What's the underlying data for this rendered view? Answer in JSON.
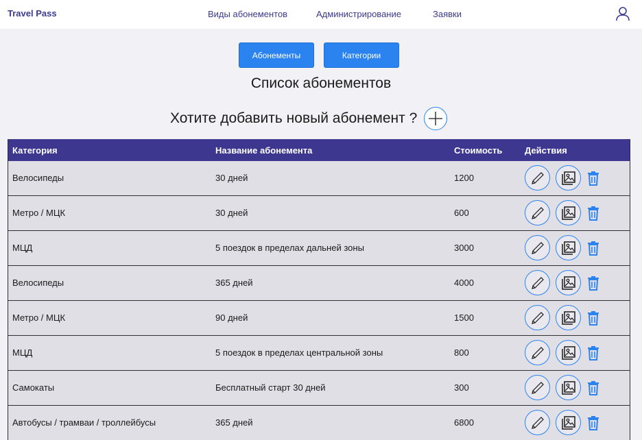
{
  "header": {
    "brand": "Travel Pass",
    "nav": [
      "Виды абонементов",
      "Администрирование",
      "Заявки"
    ]
  },
  "tabs": [
    "Абонементы",
    "Категории"
  ],
  "title": "Список абонементов",
  "add_prompt": "Хотите добавить новый абонемент ?",
  "table": {
    "columns": [
      "Категория",
      "Название абонемента",
      "Стоимость",
      "Действия"
    ],
    "rows": [
      {
        "category": "Велосипеды",
        "name": "30 дней",
        "price": "1200"
      },
      {
        "category": "Метро / МЦК",
        "name": "30 дней",
        "price": "600"
      },
      {
        "category": "МЦД",
        "name": "5 поездок в пределах дальней зоны",
        "price": "3000"
      },
      {
        "category": "Велосипеды",
        "name": "365 дней",
        "price": "4000"
      },
      {
        "category": "Метро / МЦК",
        "name": "90 дней",
        "price": "1500"
      },
      {
        "category": "МЦД",
        "name": "5 поездок в пределах центральной зоны",
        "price": "800"
      },
      {
        "category": "Самокаты",
        "name": "Бесплатный старт 30 дней",
        "price": "300"
      },
      {
        "category": "Автобусы / трамваи / троллейбусы",
        "name": "365 дней",
        "price": "6800"
      }
    ]
  },
  "icons": {
    "user": "user-icon",
    "add": "plus-icon",
    "edit": "pencil-icon",
    "image": "image-icon",
    "delete": "trash-icon"
  },
  "colors": {
    "brand": "#3b3a8f",
    "accent": "#2b83f0",
    "table_header": "#3d3790",
    "row_bg": "#e0dfe6"
  }
}
